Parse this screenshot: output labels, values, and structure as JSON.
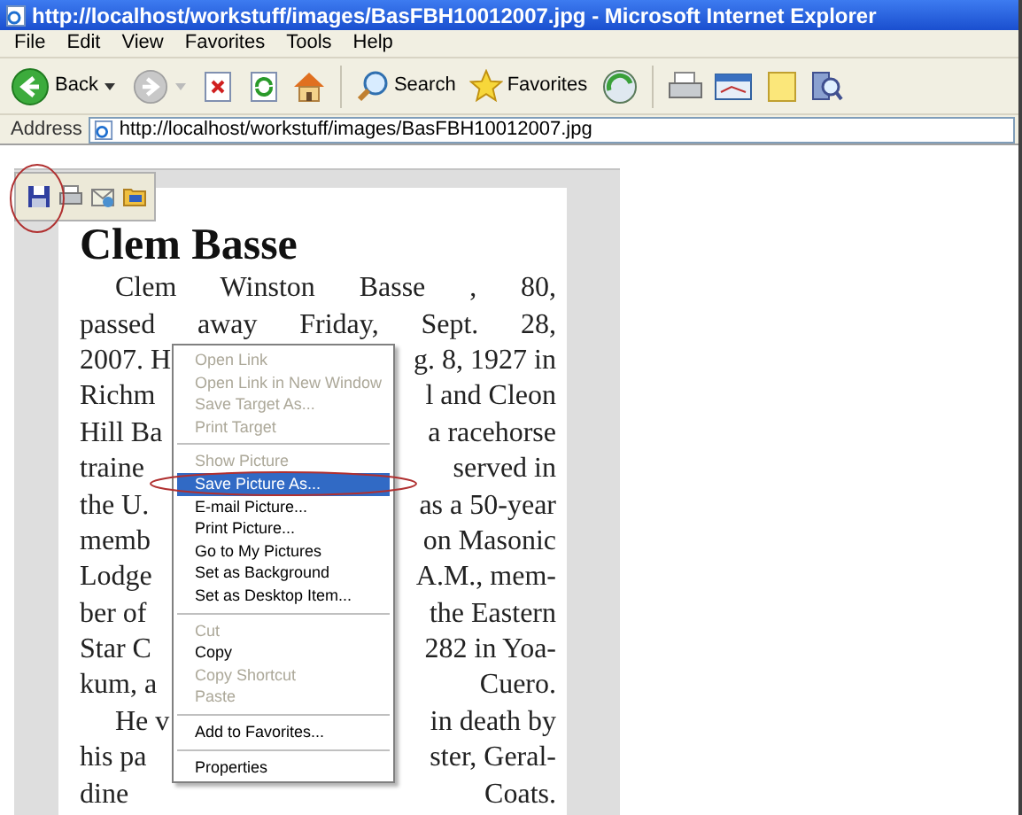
{
  "window": {
    "title": "http://localhost/workstuff/images/BasFBH10012007.jpg - Microsoft Internet Explorer"
  },
  "menu_bar": [
    "File",
    "Edit",
    "View",
    "Favorites",
    "Tools",
    "Help"
  ],
  "toolbar": {
    "back_label": "Back",
    "search_label": "Search",
    "favorites_label": "Favorites"
  },
  "address_bar": {
    "label": "Address",
    "url": "http://localhost/workstuff/images/BasFBH10012007.jpg"
  },
  "document": {
    "headline": "Clem Basse",
    "paragraphs": [
      {
        "lines": [
          {
            "left": "Clem Winston Basse , 80,"
          },
          {
            "left": "passed away Friday, Sept. 28,"
          },
          {
            "left": "2007. H",
            "right": "g. 8, 1927 in"
          },
          {
            "left": "Richm",
            "right": "l and Cleon"
          },
          {
            "left": "Hill Ba",
            "right": "a racehorse"
          },
          {
            "left": "traine",
            "right": "served in"
          },
          {
            "left": "the U.",
            "right": "as a 50-year"
          },
          {
            "left": "memb",
            "right": "on Masonic"
          },
          {
            "left": "Lodge",
            "right": "A.M., mem-"
          },
          {
            "left": "ber of",
            "right": "the Eastern"
          },
          {
            "left": "Star C",
            "right": "282 in Yoa-"
          },
          {
            "left": "kum, a",
            "right": "Cuero."
          }
        ]
      },
      {
        "lines": [
          {
            "left": "He v",
            "right": "in death by"
          },
          {
            "left": "his pa",
            "right": "ster, Geral-"
          },
          {
            "left": "dine Coats."
          }
        ]
      }
    ]
  },
  "context_menu": [
    {
      "kind": "item",
      "label": "Open Link",
      "disabled": true,
      "selected": false
    },
    {
      "kind": "item",
      "label": "Open Link in New Window",
      "disabled": true,
      "selected": false
    },
    {
      "kind": "item",
      "label": "Save Target As...",
      "disabled": true,
      "selected": false
    },
    {
      "kind": "item",
      "label": "Print Target",
      "disabled": true,
      "selected": false
    },
    {
      "kind": "separator"
    },
    {
      "kind": "item",
      "label": "Show Picture",
      "disabled": true,
      "selected": false
    },
    {
      "kind": "item",
      "label": "Save Picture As...",
      "disabled": false,
      "selected": true
    },
    {
      "kind": "item",
      "label": "E-mail Picture...",
      "disabled": false,
      "selected": false
    },
    {
      "kind": "item",
      "label": "Print Picture...",
      "disabled": false,
      "selected": false
    },
    {
      "kind": "item",
      "label": "Go to My Pictures",
      "disabled": false,
      "selected": false
    },
    {
      "kind": "item",
      "label": "Set as Background",
      "disabled": false,
      "selected": false
    },
    {
      "kind": "item",
      "label": "Set as Desktop Item...",
      "disabled": false,
      "selected": false
    },
    {
      "kind": "separator"
    },
    {
      "kind": "item",
      "label": "Cut",
      "disabled": true,
      "selected": false
    },
    {
      "kind": "item",
      "label": "Copy",
      "disabled": false,
      "selected": false
    },
    {
      "kind": "item",
      "label": "Copy Shortcut",
      "disabled": true,
      "selected": false
    },
    {
      "kind": "item",
      "label": "Paste",
      "disabled": true,
      "selected": false
    },
    {
      "kind": "separator"
    },
    {
      "kind": "item",
      "label": "Add to Favorites...",
      "disabled": false,
      "selected": false
    },
    {
      "kind": "separator"
    },
    {
      "kind": "item",
      "label": "Properties",
      "disabled": false,
      "selected": false
    }
  ]
}
